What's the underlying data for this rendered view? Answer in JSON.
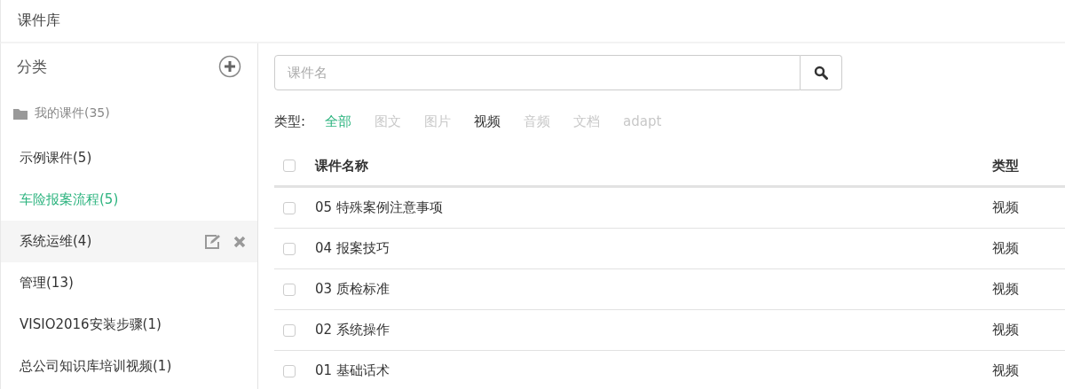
{
  "header": {
    "title": "课件库"
  },
  "sidebar": {
    "title": "分类",
    "root": {
      "label": "我的课件(35)"
    },
    "items": [
      {
        "label": "示例课件(5)",
        "selected": false,
        "hovered": false
      },
      {
        "label": "车险报案流程(5)",
        "selected": true,
        "hovered": false
      },
      {
        "label": "系统运维(4)",
        "selected": false,
        "hovered": true
      },
      {
        "label": "管理(13)",
        "selected": false,
        "hovered": false
      },
      {
        "label": "VISIO2016安装步骤(1)",
        "selected": false,
        "hovered": false
      },
      {
        "label": "总公司知识库培训视频(1)",
        "selected": false,
        "hovered": false
      }
    ]
  },
  "search": {
    "placeholder": "课件名"
  },
  "filter": {
    "label": "类型:",
    "options": [
      {
        "label": "全部",
        "selected": true,
        "disabled": false
      },
      {
        "label": "图文",
        "selected": false,
        "disabled": true
      },
      {
        "label": "图片",
        "selected": false,
        "disabled": true
      },
      {
        "label": "视频",
        "selected": false,
        "disabled": false
      },
      {
        "label": "音频",
        "selected": false,
        "disabled": true
      },
      {
        "label": "文档",
        "selected": false,
        "disabled": true
      },
      {
        "label": "adapt",
        "selected": false,
        "disabled": true
      }
    ]
  },
  "table": {
    "columns": [
      "课件名称",
      "类型"
    ],
    "all_checked": false,
    "rows": [
      {
        "name": "05 特殊案例注意事项",
        "type": "视频",
        "checked": false
      },
      {
        "name": "04 报案技巧",
        "type": "视频",
        "checked": false
      },
      {
        "name": "03 质检标准",
        "type": "视频",
        "checked": false
      },
      {
        "name": "02 系统操作",
        "type": "视频",
        "checked": false
      },
      {
        "name": "01 基础话术",
        "type": "视频",
        "checked": false
      }
    ]
  }
}
